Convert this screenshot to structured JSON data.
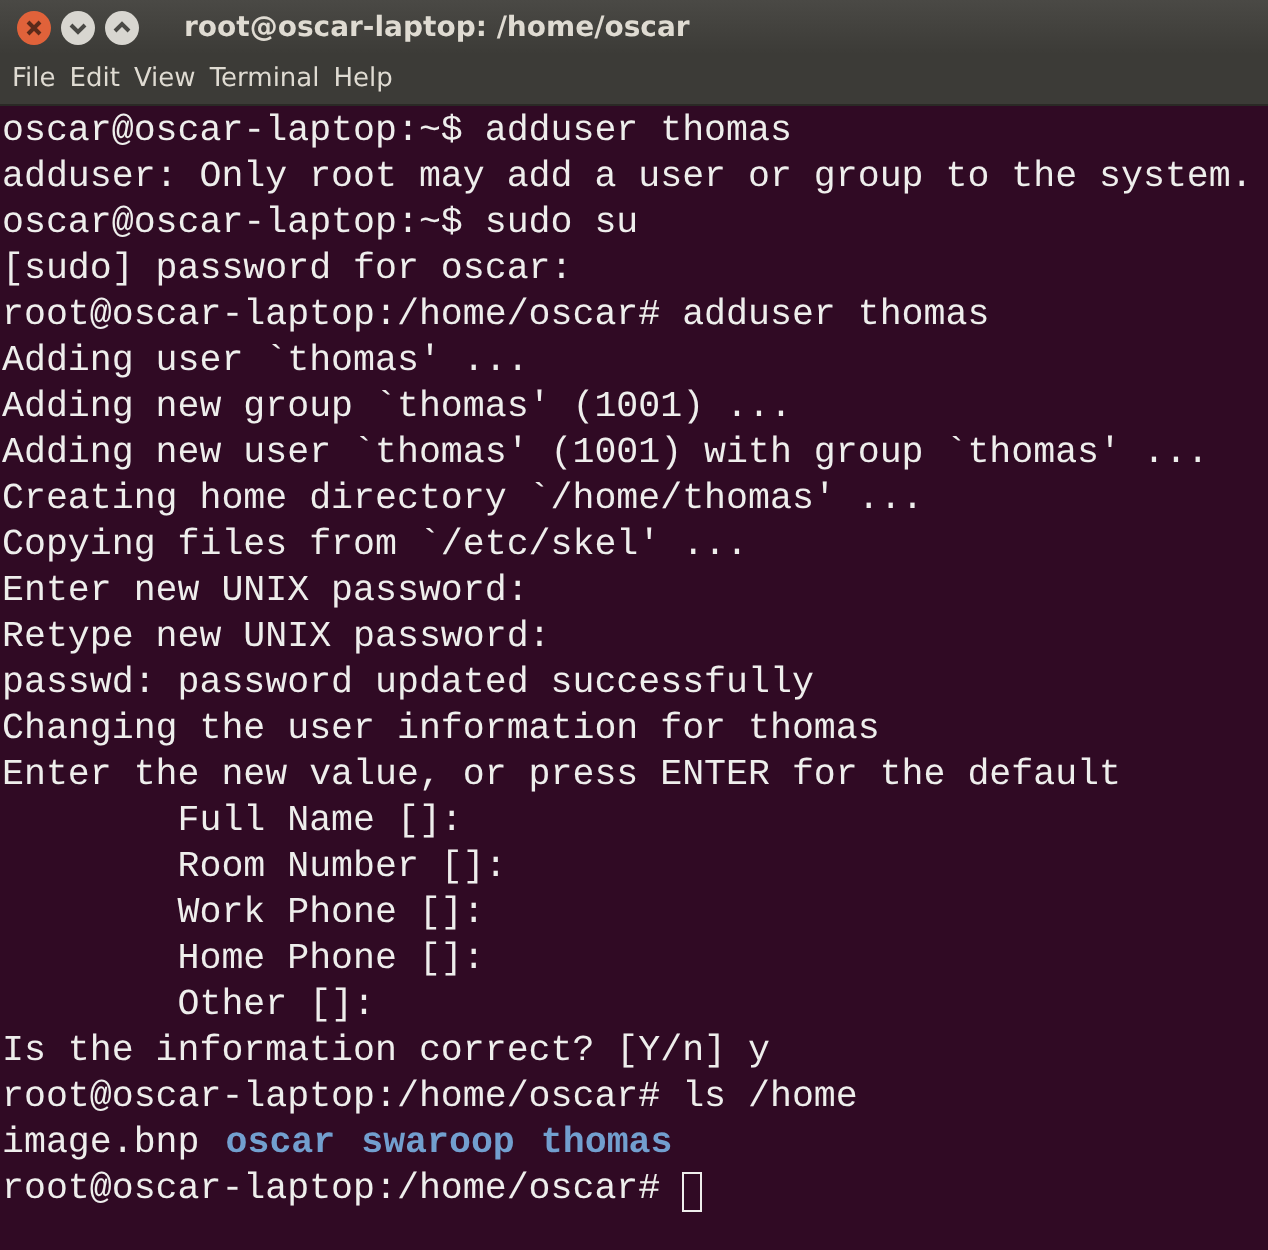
{
  "window": {
    "title": "root@oscar-laptop: /home/oscar"
  },
  "menu": [
    "File",
    "Edit",
    "View",
    "Terminal",
    "Help"
  ],
  "lines": [
    {
      "text": "oscar@oscar-laptop:~$ adduser thomas"
    },
    {
      "text": "adduser: Only root may add a user or group to the system."
    },
    {
      "text": "oscar@oscar-laptop:~$ sudo su"
    },
    {
      "text": "[sudo] password for oscar:"
    },
    {
      "text": "root@oscar-laptop:/home/oscar# adduser thomas"
    },
    {
      "text": "Adding user `thomas' ..."
    },
    {
      "text": "Adding new group `thomas' (1001) ..."
    },
    {
      "text": "Adding new user `thomas' (1001) with group `thomas' ..."
    },
    {
      "text": "Creating home directory `/home/thomas' ..."
    },
    {
      "text": "Copying files from `/etc/skel' ..."
    },
    {
      "text": "Enter new UNIX password:"
    },
    {
      "text": "Retype new UNIX password:"
    },
    {
      "text": "passwd: password updated successfully"
    },
    {
      "text": "Changing the user information for thomas"
    },
    {
      "text": "Enter the new value, or press ENTER for the default"
    },
    {
      "text": "        Full Name []:"
    },
    {
      "text": "        Room Number []:"
    },
    {
      "text": "        Work Phone []:"
    },
    {
      "text": "        Home Phone []:"
    },
    {
      "text": "        Other []:"
    },
    {
      "text": "Is the information correct? [Y/n] y"
    },
    {
      "text": "root@oscar-laptop:/home/oscar# ls /home"
    },
    {
      "items": [
        {
          "text": "image.bnp",
          "kind": "file"
        },
        {
          "text": "oscar",
          "kind": "dir"
        },
        {
          "text": "swaroop",
          "kind": "dir"
        },
        {
          "text": "thomas",
          "kind": "dir"
        }
      ]
    },
    {
      "text": "root@oscar-laptop:/home/oscar# ",
      "cursor": true
    }
  ]
}
